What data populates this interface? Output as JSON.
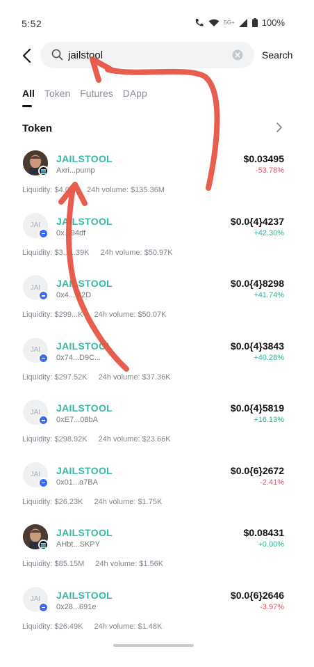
{
  "status_bar": {
    "time": "5:52",
    "network": "5G+",
    "battery": "100%"
  },
  "search": {
    "query": "jailstool",
    "button_label": "Search"
  },
  "tabs": [
    {
      "label": "All",
      "active": true
    },
    {
      "label": "Token",
      "active": false
    },
    {
      "label": "Futures",
      "active": false
    },
    {
      "label": "DApp",
      "active": false
    }
  ],
  "section": {
    "title": "Token"
  },
  "tokens": [
    {
      "avatar": "photo",
      "avatar_text": "",
      "chain": "sol",
      "name": "JAILSTOOL",
      "address": "Axri...pump",
      "price": "$0.03495",
      "change": "-53.78%",
      "direction": "down",
      "liquidity": "Liquidity: $4.0...",
      "volume": "24h volume: $135.36M"
    },
    {
      "avatar": "text",
      "avatar_text": "JAI",
      "chain": "eth",
      "name": "JAILSTOOL",
      "address": "0x...94df",
      "price": "$0.0{4}4237",
      "change": "+42.30%",
      "direction": "up",
      "liquidity": "Liquidity: $3...1.39K",
      "volume": "24h volume: $50.97K"
    },
    {
      "avatar": "text",
      "avatar_text": "JAI",
      "chain": "eth",
      "name": "JAILSTOOL",
      "address": "0x4...f42D",
      "price": "$0.0{4}8298",
      "change": "+41.74%",
      "direction": "up",
      "liquidity": "Liquidity: $299...K",
      "volume": "24h volume: $50.07K"
    },
    {
      "avatar": "text",
      "avatar_text": "JAI",
      "chain": "eth",
      "name": "JAILSTOOL",
      "address": "0x74...D9C...",
      "price": "$0.0{4}3843",
      "change": "+40.28%",
      "direction": "up",
      "liquidity": "Liquidity: $297.52K",
      "volume": "24h volume: $37.36K"
    },
    {
      "avatar": "text",
      "avatar_text": "JAI",
      "chain": "eth",
      "name": "JAILSTOOL",
      "address": "0xE7...08bA",
      "price": "$0.0{4}5819",
      "change": "+16.13%",
      "direction": "up",
      "liquidity": "Liquidity: $298.92K",
      "volume": "24h volume: $23.66K"
    },
    {
      "avatar": "text",
      "avatar_text": "JAI",
      "chain": "eth",
      "name": "JAILSTOOL",
      "address": "0x01...a7BA",
      "price": "$0.0{6}2672",
      "change": "-2.41%",
      "direction": "down",
      "liquidity": "Liquidity: $26.23K",
      "volume": "24h volume: $1.75K"
    },
    {
      "avatar": "photo",
      "avatar_text": "",
      "chain": "sol",
      "name": "JAILSTOOL",
      "address": "AHbt...SKPY",
      "price": "$0.08431",
      "change": "+0.00%",
      "direction": "up",
      "liquidity": "Liquidity: $85.15M",
      "volume": "24h volume: $1.56K"
    },
    {
      "avatar": "text",
      "avatar_text": "JAI",
      "chain": "eth",
      "name": "JAILSTOOL",
      "address": "0x28...691e",
      "price": "$0.0{6}2646",
      "change": "-3.97%",
      "direction": "down",
      "liquidity": "Liquidity: $26.49K",
      "volume": "24h volume: $1.48K"
    }
  ],
  "colors": {
    "accent_name": "#36b8a7",
    "up": "#2bb39a",
    "down": "#e0556a",
    "annotation": "#e5503f"
  }
}
